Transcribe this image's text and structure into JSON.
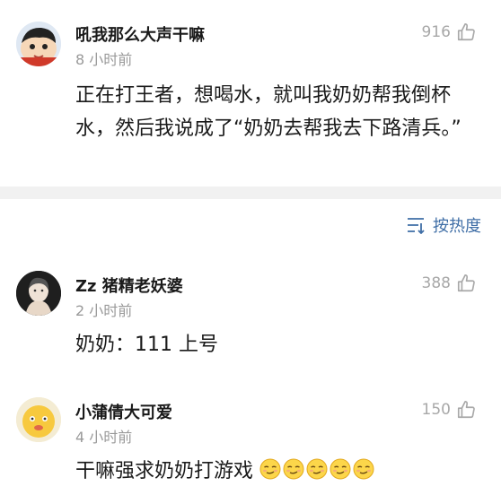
{
  "comments": [
    {
      "author": "吼我那么大声干嘛",
      "time": "8 小时前",
      "likes": "916",
      "text": "正在打王者，想喝水，就叫我奶奶帮我倒杯水，然后我说成了“奶奶去帮我去下路清兵。”",
      "avatar_icon": "cartoon-boy-avatar"
    },
    {
      "author": "Zz 猪精老妖婆",
      "time": "2 小时前",
      "likes": "388",
      "text": "奶奶：111 上号",
      "avatar_icon": "sketch-girl-avatar"
    },
    {
      "author": "小蒲倩大可爱",
      "time": "4 小时前",
      "likes": "150",
      "text": "干嘛强求奶奶打游戏",
      "avatar_icon": "yellow-emoji-avatar",
      "emoji_count": 5
    }
  ],
  "sort": {
    "label": "按热度",
    "icon": "sort-icon"
  },
  "colors": {
    "link": "#3f6ea6",
    "muted": "#9a9a9a",
    "divider": "#f1f1f1"
  }
}
